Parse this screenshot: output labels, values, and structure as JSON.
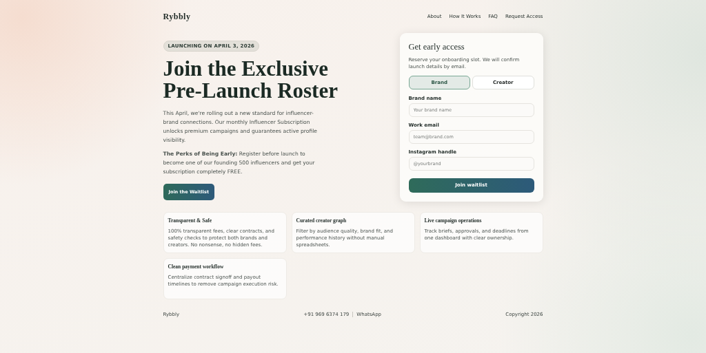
{
  "header": {
    "logo": "Rybbly",
    "nav": [
      "About",
      "How It Works",
      "FAQ",
      "Request Access"
    ]
  },
  "hero": {
    "badge": "LAUNCHING ON APRIL 3, 2026",
    "title_lines": [
      "Join the Exclusive",
      "Pre-Launch Roster"
    ],
    "paragraphs": [
      "This April, we're rolling out a new standard for influencer-brand connections. Our monthly Influencer Subscription unlocks premium campaigns and guarantees active profile visibility.",
      "**The Perks of Being Early:** Register before launch to become one of our founding 500 influencers and get your subscription completely FREE."
    ],
    "button": "Join the Waitlist"
  },
  "signup": {
    "title": "Get early access",
    "description": "Reserve your onboarding slot. We will confirm launch details by email.",
    "roles": [
      {
        "label": "Brand",
        "selected": true
      },
      {
        "label": "Creator",
        "selected": false
      }
    ],
    "fields": [
      {
        "label": "Brand name",
        "placeholder": "Your brand name"
      },
      {
        "label": "Work email",
        "placeholder": "team@brand.com"
      },
      {
        "label": "Instagram handle",
        "placeholder": "@yourbrand"
      }
    ],
    "button": "Join waitlist"
  },
  "features": [
    {
      "title": "Transparent & Safe",
      "text": "100% transparent fees, clear contracts, and safety checks to protect both brands and creators. No nonsense, no hidden fees."
    },
    {
      "title": "Curated creator graph",
      "text": "Filter by audience quality, brand fit, and performance history without manual spreadsheets."
    },
    {
      "title": "Live campaign operations",
      "text": "Track briefs, approvals, and deadlines from one dashboard with clear ownership."
    },
    {
      "title": "Clean payment workflow",
      "text": "Centralize contract signoff and payout timelines to remove campaign execution risk."
    }
  ],
  "footer": {
    "brand": "Rybbly",
    "phone": "+91 969 6374 179",
    "link": "WhatsApp",
    "copyright": "Copyright 2026"
  }
}
